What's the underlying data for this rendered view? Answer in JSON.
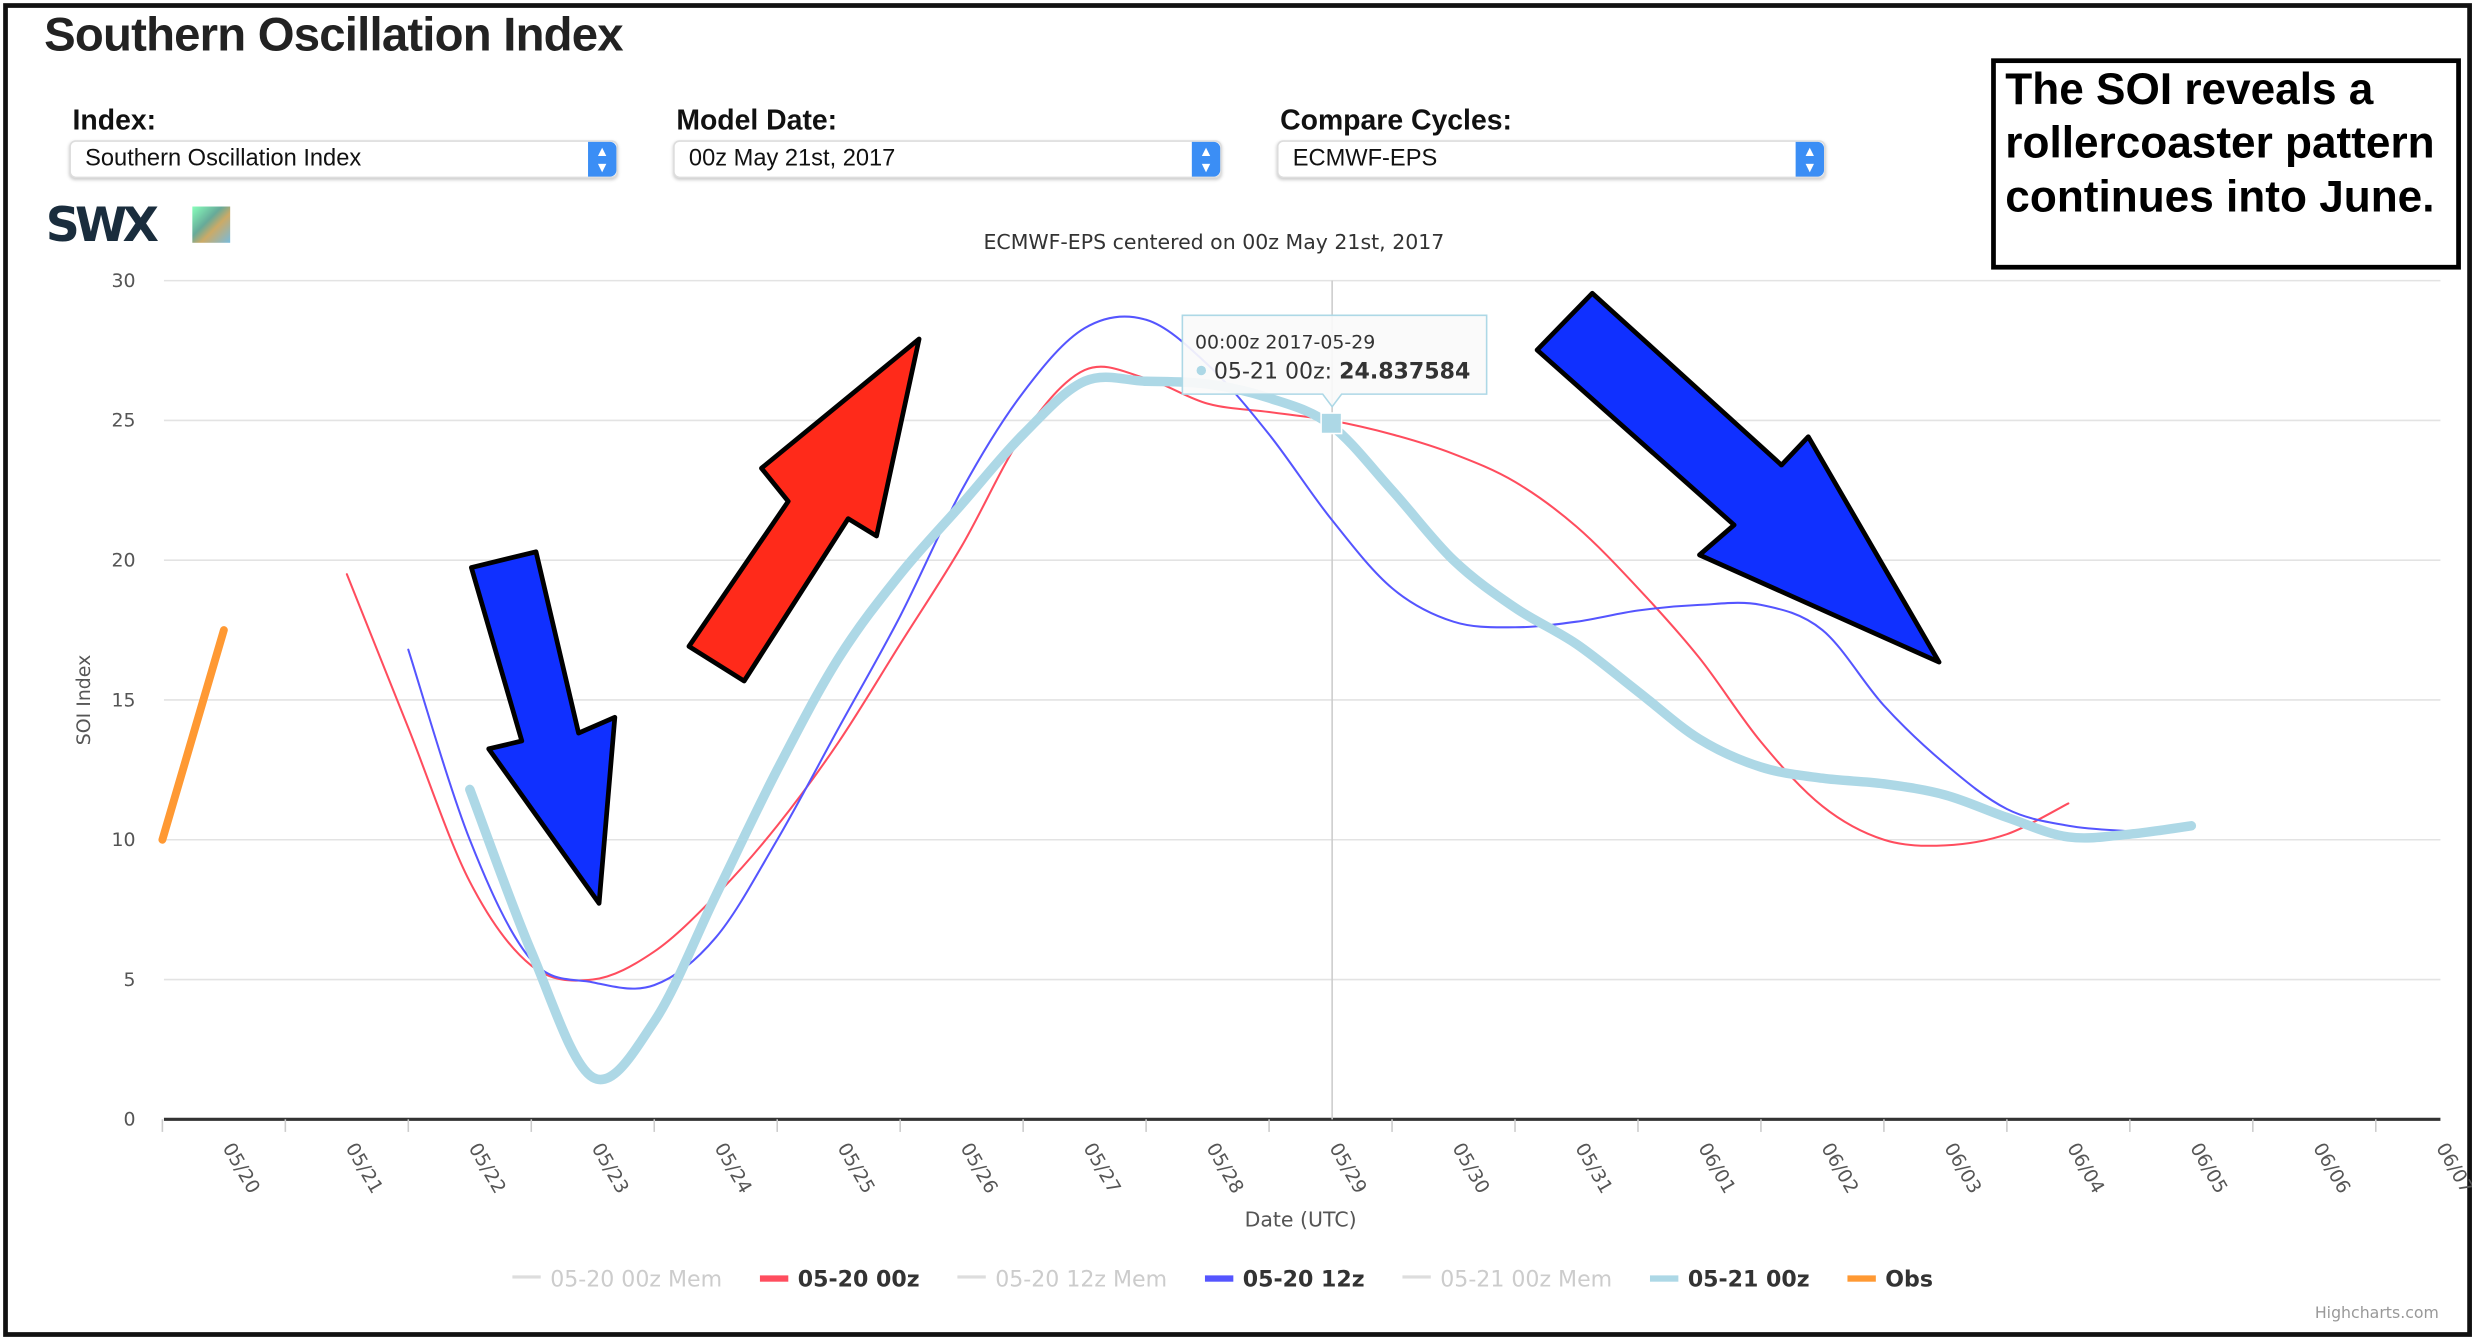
{
  "header": {
    "title": "Southern Oscillation Index"
  },
  "controls": [
    {
      "label": "Index:",
      "value": "Southern Oscillation Index"
    },
    {
      "label": "Model Date:",
      "value": "00z May 21st, 2017"
    },
    {
      "label": "Compare Cycles:",
      "value": "ECMWF-EPS"
    }
  ],
  "logo": "SWX",
  "annotation": "The SOI reveals a rollercoaster pattern continues into June.",
  "tooltip": {
    "header": "00:00z 2017-05-29",
    "series": "05-21 00z",
    "value": "24.837584",
    "marker_color": "#add8e6"
  },
  "credit": "Highcharts.com",
  "arrow_colors": {
    "red": "#ff2a1a",
    "blue": "#1030ff"
  },
  "chart_data": {
    "type": "line",
    "title": "ECMWF-EPS centered on 00z May 21st, 2017",
    "xlabel": "Date (UTC)",
    "ylabel": "SOI Index",
    "ylim": [
      0,
      30
    ],
    "yticks": [
      0,
      5,
      10,
      15,
      20,
      25,
      30
    ],
    "xticks": [
      "05/20",
      "05/21",
      "05/22",
      "05/23",
      "05/24",
      "05/25",
      "05/26",
      "05/27",
      "05/28",
      "05/29",
      "05/30",
      "05/31",
      "06/01",
      "06/02",
      "06/03",
      "06/04",
      "06/05",
      "06/06",
      "06/07"
    ],
    "grid": true,
    "legend_placement": "bottom",
    "legend": [
      {
        "name": "05-20 00z Mem",
        "color": "#dddddd",
        "hidden": true
      },
      {
        "name": "05-20 00z",
        "color": "#ff4d5e",
        "hidden": false
      },
      {
        "name": "05-20 12z Mem",
        "color": "#dddddd",
        "hidden": true
      },
      {
        "name": "05-20 12z",
        "color": "#5555ff",
        "hidden": false
      },
      {
        "name": "05-21 00z Mem",
        "color": "#dddddd",
        "hidden": true
      },
      {
        "name": "05-21 00z",
        "color": "#add8e6",
        "hidden": false
      },
      {
        "name": "Obs",
        "color": "#ff9933",
        "hidden": false
      }
    ],
    "series": [
      {
        "name": "Obs",
        "color": "#ff9933",
        "width": 5,
        "start": "2017-05-19 12",
        "step_hours": 12,
        "values": [
          10,
          17.5
        ]
      },
      {
        "name": "05-20 00z",
        "color": "#ff4d5e",
        "width": 1.3,
        "start": "2017-05-21 00",
        "step_hours": 12,
        "values": [
          19.5,
          14,
          8.5,
          5.5,
          5,
          6,
          8,
          10.5,
          13.5,
          17,
          20.5,
          24.5,
          26.8,
          26.5,
          25.6,
          25.3,
          25,
          24.5,
          23.8,
          22.8,
          21.2,
          19,
          16.5,
          13.5,
          11.2,
          10,
          9.8,
          10.2,
          11.3
        ]
      },
      {
        "name": "05-20 12z",
        "color": "#5555ff",
        "width": 1.3,
        "start": "2017-05-21 12",
        "step_hours": 12,
        "values": [
          16.8,
          10,
          5.7,
          4.9,
          4.8,
          6.5,
          10,
          14,
          18,
          22.5,
          26,
          28.3,
          28.6,
          27,
          24.5,
          21.5,
          19,
          17.8,
          17.6,
          17.8,
          18.2,
          18.4,
          18.4,
          17.5,
          14.8,
          12.7,
          11.1,
          10.5,
          10.3
        ]
      },
      {
        "name": "05-21 00z",
        "color": "#add8e6",
        "width": 6,
        "start": "2017-05-22 00",
        "step_hours": 12,
        "values": [
          11.8,
          6,
          1.5,
          3.5,
          8,
          12.5,
          16.5,
          19.5,
          22,
          24.5,
          26.4,
          26.4,
          26.3,
          25.8,
          24.837584,
          22.5,
          20,
          18.3,
          17,
          15.3,
          13.6,
          12.6,
          12.2,
          12,
          11.6,
          10.8,
          10.1,
          10.2,
          10.5
        ]
      }
    ]
  }
}
